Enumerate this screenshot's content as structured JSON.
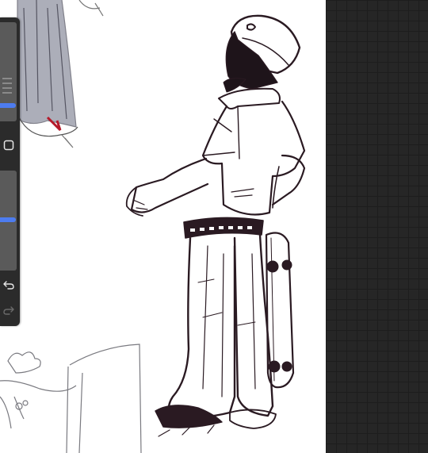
{
  "app": {
    "canvas_background": "#ffffff",
    "workspace_background": "#262626",
    "sidebar_background": "#2b2b2b",
    "accent_color": "#4d7cf0"
  },
  "sidebar": {
    "brush_size_slider": {
      "value": 0.15
    },
    "opacity_slider": {
      "value": 0.52
    },
    "modify_button": {
      "icon": "square-icon"
    },
    "undo_button": {
      "icon": "undo-arrow-icon"
    },
    "redo_button": {
      "icon": "redo-arrow-icon",
      "enabled": false
    }
  },
  "canvas": {
    "content": "sketch-drawing"
  }
}
